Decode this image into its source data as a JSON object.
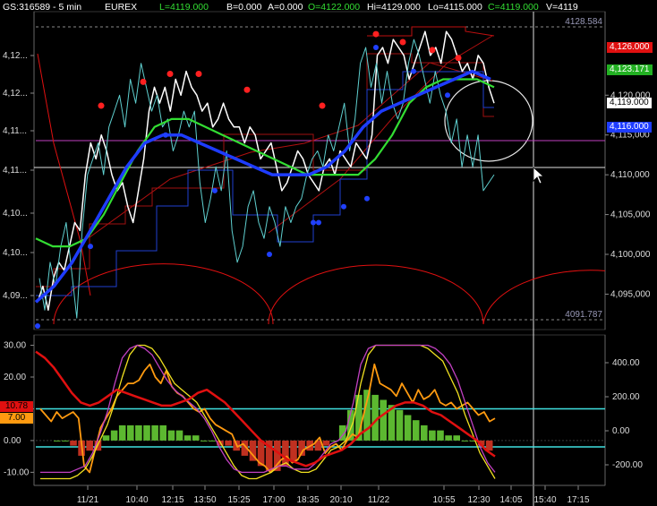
{
  "header": {
    "symbol": "GS:316589 - 5 min",
    "exchange": "EUREX",
    "last": "L=4119.000",
    "bid": "B=0.000",
    "ask": "A=0.000",
    "open": "O=4122.000",
    "high": "Hi=4129.000",
    "low": "Lo=4115.000",
    "close": "C=4119.000",
    "volume": "V=4119"
  },
  "colors": {
    "background": "#000000",
    "price_white": "#ffffff",
    "cyan": "#5fd0d0",
    "green_ma": "#33dd33",
    "blue_ma": "#1e3cff",
    "red": "#e01010",
    "magenta": "#c040c0",
    "yellow": "#f0e020",
    "orange": "#ff9a10",
    "histogram_green": "#5cb830",
    "histogram_red": "#c03020"
  },
  "chart_data": [
    {
      "type": "line",
      "panel": "price",
      "x_tick_labels": [
        "11/21",
        "10:40",
        "12:15",
        "13:50",
        "15:25",
        "17:00",
        "18:35",
        "20:10",
        "11/22",
        "10:55",
        "12:30",
        "14:05",
        "15:40",
        "17:15"
      ],
      "left_axis_labels": [
        "4,12...",
        "4,12...",
        "4,11...",
        "4,11...",
        "4,10...",
        "4,10...",
        "4,09..."
      ],
      "right_axis_ticks": [
        "4,120,000",
        "4,115,000",
        "4,110,000",
        "4,105,000",
        "4,100,000",
        "4,095,000"
      ],
      "ylim": [
        4091.787,
        4128.584
      ],
      "reference_lines": [
        {
          "label": "4128.584",
          "value": 4128.584
        },
        {
          "label": "4091.787",
          "value": 4091.787
        }
      ],
      "tags": [
        {
          "label": "4,126.000",
          "value": 4126.0,
          "color": "#e01010"
        },
        {
          "label": "4,123.171",
          "value": 4123.171,
          "color": "#22b022"
        },
        {
          "label": "4,119.000",
          "value": 4119.0,
          "color": "#ffffff"
        },
        {
          "label": "4,116.000",
          "value": 4116.0,
          "color": "#1e3cff"
        }
      ],
      "series": [
        {
          "color": "white",
          "values": [
            4094,
            4096,
            4093,
            4097,
            4099,
            4098,
            4101,
            4104,
            4103,
            4110,
            4114,
            4112,
            4115,
            4113,
            4110,
            4108,
            4109,
            4106,
            4104,
            4108,
            4112,
            4118,
            4121,
            4119,
            4121,
            4118,
            4122,
            4120,
            4123,
            4121,
            4120,
            4118,
            4119,
            4116,
            4117,
            4119,
            4117,
            4116,
            4116,
            4114,
            4116,
            4115,
            4112,
            4113,
            4114,
            4111,
            4108,
            4109,
            4111,
            4113,
            4112,
            4110,
            4109,
            4108,
            4111,
            4112,
            4110,
            4113,
            4112,
            4111,
            4114,
            4113,
            4112,
            4115,
            4125,
            4126,
            4124,
            4127,
            4126,
            4125,
            4122,
            4124,
            4126,
            4128,
            4125,
            4126,
            4124,
            4128,
            4127,
            4125,
            4123,
            4124,
            4122,
            4125,
            4124,
            4121,
            4119
          ]
        },
        {
          "color": "cyan",
          "values": [
            4097,
            4093,
            4099,
            4096,
            4101,
            4104,
            4098,
            4092,
            4103,
            4110,
            4112,
            4114,
            4110,
            4116,
            4118,
            4120,
            4116,
            4122,
            4119,
            4124,
            4121,
            4118,
            4120,
            4116,
            4117,
            4113,
            4115,
            4118,
            4116,
            4118,
            4109,
            4104,
            4107,
            4111,
            4108,
            4113,
            4103,
            4099,
            4101,
            4106,
            4108,
            4104,
            4102,
            4106,
            4104,
            4101,
            4106,
            4104,
            4106,
            4107,
            4110,
            4112,
            4113,
            4111,
            4115,
            4113,
            4116,
            4119,
            4113,
            4117,
            4124,
            4126,
            4121,
            4124,
            4119,
            4123,
            4119,
            4117,
            4119,
            4124,
            4127,
            4125,
            4122,
            4119,
            4123,
            4120,
            4118,
            4114,
            4117,
            4111,
            4115,
            4111,
            4115,
            4108,
            4109,
            4110
          ]
        },
        {
          "color": "green",
          "values": [
            4102,
            4101,
            4101,
            4102,
            4105,
            4109,
            4113,
            4116,
            4117,
            4117,
            4116,
            4115,
            4114,
            4113,
            4112,
            4111,
            4110,
            4110,
            4110,
            4110,
            4112,
            4115,
            4119,
            4121,
            4122,
            4122,
            4122,
            4121
          ]
        },
        {
          "color": "blue",
          "values": [
            4094,
            4096,
            4099,
            4103,
            4107,
            4111,
            4114,
            4115,
            4115,
            4114,
            4113,
            4112,
            4111,
            4110,
            4110,
            4110,
            4111,
            4113,
            4116,
            4118,
            4119,
            4120,
            4121,
            4122,
            4123,
            4122
          ]
        }
      ],
      "red_dots_values": [
        4118,
        4121,
        4122,
        4122,
        4120,
        4118,
        4127,
        4126,
        4125,
        4124
      ],
      "blue_dots_values": [
        4091,
        4101,
        4115,
        4108,
        4100,
        4104,
        4104,
        4106,
        4107,
        4126,
        4123,
        4120
      ],
      "cycle_arcs": [
        "half-circle cycle troughs near 11/21, 17:00 and 12:30"
      ]
    },
    {
      "type": "line",
      "panel": "oscillator",
      "left_axis_ticks": [
        "30.00",
        "20.00",
        "10.00",
        "0.00",
        "-10.00"
      ],
      "right_axis_ticks": [
        "400.00",
        "200.00",
        "0.00",
        "-200.00"
      ],
      "ylim": [
        -13,
        31
      ],
      "tags": [
        {
          "label": "10.78",
          "value": 10.78,
          "color": "#e01010"
        },
        {
          "label": "7.00",
          "value": 7.0,
          "color": "#ff9a10"
        }
      ],
      "reference_lines": [
        10.0,
        -2.0
      ],
      "series": [
        {
          "color": "orange",
          "values": [
            10,
            8,
            6,
            9,
            7,
            8,
            9,
            7,
            -8,
            -10,
            -3,
            4,
            7,
            10,
            14,
            16,
            18,
            18,
            19,
            22,
            24,
            20,
            18,
            22,
            17,
            15,
            14,
            12,
            10,
            9,
            10,
            7,
            5,
            4,
            3,
            2,
            -2,
            -1,
            -3,
            -5,
            -7,
            -8,
            -10,
            -8,
            -6,
            -5,
            -7,
            -6,
            -3,
            -2,
            -1,
            1,
            -4,
            -2,
            -1,
            -3,
            0,
            2,
            1,
            8,
            15,
            24,
            18,
            17,
            16,
            14,
            18,
            15,
            12,
            16,
            13,
            14,
            16,
            12,
            11,
            12,
            10,
            11,
            12,
            10,
            8,
            9,
            6,
            7
          ]
        },
        {
          "color": "yellow",
          "values": [
            -12,
            -12,
            -12,
            -12,
            -12,
            -11,
            -9,
            -5,
            0,
            5,
            12,
            20,
            27,
            30,
            30,
            29,
            26,
            22,
            18,
            16,
            14,
            12,
            8,
            4,
            0,
            -4,
            -8,
            -11,
            -12,
            -12,
            -11,
            -10,
            -8,
            -7,
            -9,
            -10,
            -10,
            -9,
            -6,
            -3,
            -2,
            0,
            6,
            18,
            27,
            30,
            30,
            30,
            30,
            30,
            30,
            30,
            29,
            27,
            25,
            20,
            15,
            8,
            2,
            -4,
            -8,
            -12
          ]
        },
        {
          "color": "magenta",
          "values": [
            -10,
            -10,
            -10,
            -10,
            -10,
            -9,
            -8,
            -4,
            2,
            9,
            18,
            26,
            29,
            30,
            29,
            27,
            23,
            19,
            16,
            14,
            12,
            10,
            7,
            3,
            -2,
            -6,
            -9,
            -10,
            -10,
            -10,
            -10,
            -9,
            -8,
            -8,
            -9,
            -9,
            -9,
            -7,
            -4,
            -1,
            0,
            3,
            12,
            24,
            29,
            30,
            30,
            30,
            30,
            30,
            30,
            30,
            30,
            29,
            27,
            24,
            19,
            12,
            5,
            -2,
            -7,
            -10
          ]
        },
        {
          "color": "red",
          "values": [
            28,
            26,
            23,
            19,
            15,
            12,
            11,
            12,
            14,
            16,
            15,
            14,
            13,
            12,
            11,
            11,
            12,
            13,
            15,
            16,
            14,
            12,
            9,
            6,
            3,
            0,
            -2,
            -4,
            -6,
            -7,
            -8,
            -7,
            -5,
            -4,
            -3,
            -1,
            2,
            4,
            7,
            9,
            11,
            12,
            12,
            11,
            9,
            8,
            6,
            4,
            2,
            0,
            -3,
            -5
          ]
        }
      ],
      "histogram_values": [
        0,
        0,
        -1,
        -3,
        -2,
        -2,
        1,
        2,
        3,
        3,
        3,
        3,
        3,
        3,
        2,
        2,
        1,
        1,
        0,
        0,
        -1,
        -1,
        -2,
        -3,
        -4,
        -5,
        -6,
        -6,
        -5,
        -4,
        -3,
        -2,
        -2,
        -1,
        0,
        3,
        6,
        9,
        10,
        9,
        8,
        7,
        6,
        5,
        4,
        3,
        2,
        2,
        1,
        1,
        0,
        0,
        -1,
        -2
      ]
    }
  ]
}
